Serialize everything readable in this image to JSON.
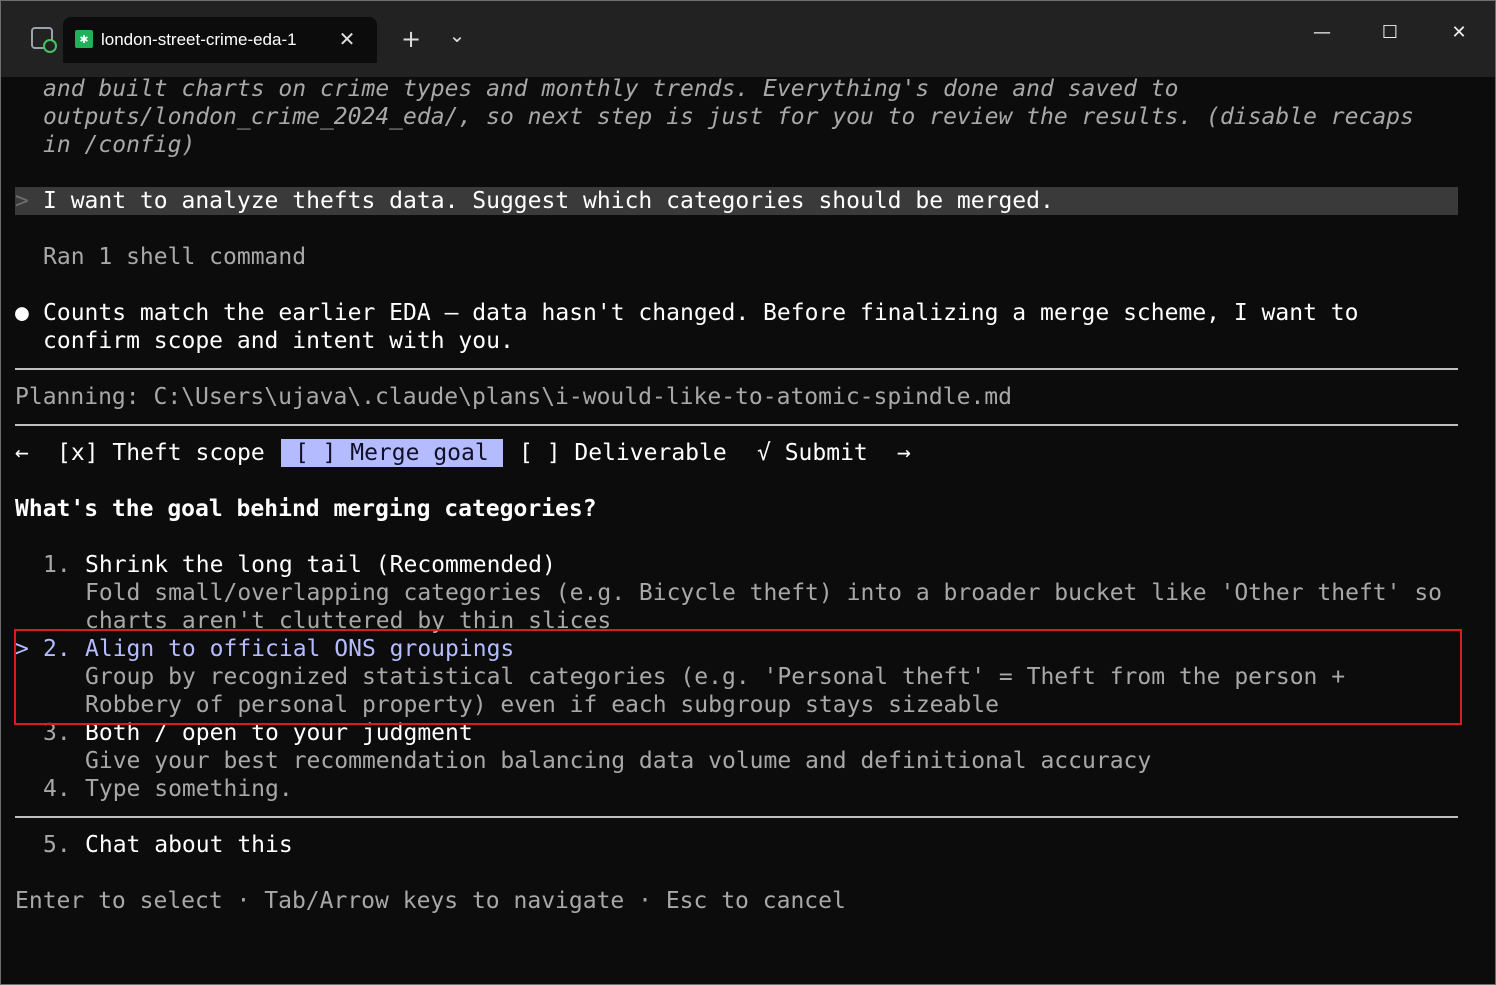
{
  "titlebar": {
    "tab_title": "london-street-crime-eda-1",
    "tab_icon": "terminal-tab-icon",
    "new_tab": "+",
    "dropdown": "⌄",
    "close": "✕",
    "minimize": "—",
    "maximize": "☐",
    "close_window": "✕"
  },
  "terminal": {
    "recap_line1": "and built charts on crime types and monthly trends. Everything's done and saved to",
    "recap_line2": "outputs/london_crime_2024_eda/, so next step is just for you to review the results. (disable recaps",
    "recap_line3": "in /config)",
    "prompt_marker": ">",
    "prompt_text": "I want to analyze thefts data. Suggest which categories should be merged.",
    "ran_command": "Ran 1 shell command",
    "bullet": "●",
    "reply_line1": "Counts match the earlier EDA – data hasn't changed. Before finalizing a merge scheme, I want to",
    "reply_line2": "confirm scope and intent with you.",
    "planning": "Planning: C:\\Users\\ujava\\.claude\\plans\\i-would-like-to-atomic-spindle.md"
  },
  "stepper": {
    "prev_arrow": "←",
    "step1": "[x] Theft scope",
    "step2": " [ ] Merge goal ",
    "step3": "[ ] Deliverable",
    "step4": "√ Submit",
    "next_arrow": "→"
  },
  "question": "What's the goal behind merging categories?",
  "options": [
    {
      "marker": "  ",
      "number": "1.",
      "title": "Shrink the long tail (Recommended)",
      "desc1": "Fold small/overlapping categories (e.g. Bicycle theft) into a broader bucket like 'Other theft' so",
      "desc2": "charts aren't cluttered by thin slices"
    },
    {
      "marker": "> ",
      "number": "2.",
      "title": "Align to official ONS groupings",
      "desc1": "Group by recognized statistical categories (e.g. 'Personal theft' = Theft from the person +",
      "desc2": "Robbery of personal property) even if each subgroup stays sizeable"
    },
    {
      "marker": "  ",
      "number": "3.",
      "title": "Both / open to your judgment",
      "desc1": "Give your best recommendation balancing data volume and definitional accuracy"
    },
    {
      "marker": "  ",
      "number": "4.",
      "title": "Type something."
    },
    {
      "marker": "  ",
      "number": "5.",
      "title": "Chat about this"
    }
  ],
  "footer": "Enter to select · Tab/Arrow keys to navigate · Esc to cancel",
  "colors": {
    "background": "#0c0c0c",
    "selected": "#b4bcff",
    "annotation_box": "#e0191f"
  }
}
